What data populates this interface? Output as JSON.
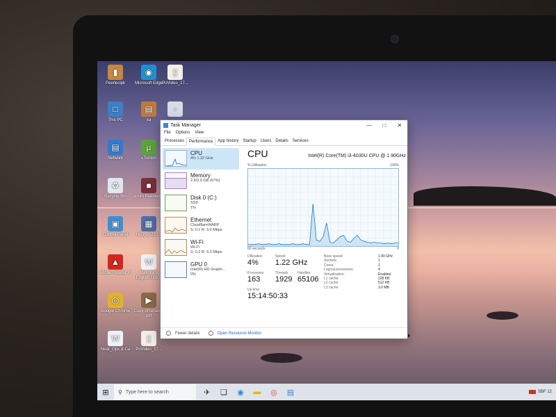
{
  "desktop": {
    "icons": [
      {
        "label": "Peerlecipk",
        "icon": "folder-icon",
        "color": "#c6893a"
      },
      {
        "label": "Microsoft Edge",
        "icon": "edge-icon",
        "color": "#1f8fd0"
      },
      {
        "label": "PoVideo_17...",
        "icon": "file-icon",
        "color": "#f4eee8"
      },
      {
        "label": "This PC",
        "icon": "computer-icon",
        "color": "#3b7fc9"
      },
      {
        "label": "xa",
        "icon": "archive-icon",
        "color": "#c07a3a"
      },
      {
        "label": "",
        "icon": "document-icon",
        "color": "#d7dce6"
      },
      {
        "label": "Network",
        "icon": "network-icon",
        "color": "#2f7bd0"
      },
      {
        "label": "uTorrent",
        "icon": "utorrent-icon",
        "color": "#5ba43a"
      },
      {
        "label": "Recycle Bin",
        "icon": "recycle-bin-icon",
        "color": "#dfe7ef"
      },
      {
        "label": "rerum Peerlecipk",
        "icon": "image-icon",
        "color": "#7a2f3a"
      },
      {
        "label": "Control Panel",
        "icon": "control-panel-icon",
        "color": "#3e8fcf"
      },
      {
        "label": "IMG_20230...",
        "icon": "photo-icon",
        "color": "#4d6fa6"
      },
      {
        "label": "Adobe Reader XI",
        "icon": "adobe-reader-icon",
        "color": "#d2271f"
      },
      {
        "label": "Stationary English Doc...",
        "icon": "word-icon",
        "color": "#eef2f8"
      },
      {
        "label": "Google Chrome",
        "icon": "chrome-icon",
        "color": "#e0b22c"
      },
      {
        "label": "Copy of rename pdf",
        "icon": "shortcut-icon",
        "color": "#8a6a48"
      },
      {
        "label": "Near_Ops & Ca",
        "icon": "word-doc-icon",
        "color": "#eef2f8"
      },
      {
        "label": "PoVideo_17...",
        "icon": "file-icon",
        "color": "#f4eee8"
      }
    ]
  },
  "taskmanager": {
    "title": "Task Manager",
    "menu": [
      "File",
      "Options",
      "View"
    ],
    "tabs": [
      "Processes",
      "Performance",
      "App history",
      "Startup",
      "Users",
      "Details",
      "Services"
    ],
    "active_tab": "Performance",
    "sidebar": [
      {
        "name": "CPU",
        "sub1": "4%  1.22 GHz",
        "sub2": ""
      },
      {
        "name": "Memory",
        "sub1": "2.6/3.9 GB (67%)",
        "sub2": ""
      },
      {
        "name": "Disk 0 (C:)",
        "sub1": "SSD",
        "sub2": "1%"
      },
      {
        "name": "Ethernet",
        "sub1": "CloudflareWARP",
        "sub2": "S: 0.1  R: 3.0 Mbps"
      },
      {
        "name": "Wi-Fi",
        "sub1": "Wi-Fi",
        "sub2": "S: 0.2  R: 3.2 Mbps"
      },
      {
        "name": "GPU 0",
        "sub1": "Intel(R) HD Graphi...",
        "sub2": "0%"
      }
    ],
    "panel": {
      "title": "CPU",
      "model": "Intel(R) Core(TM) i3-4030U CPU @ 1.90GHz",
      "graph_label_left": "% Utilization",
      "graph_label_right": "100%",
      "graph_foot_left": "60 seconds",
      "graph_foot_right": "0",
      "utilization": 0.04,
      "stats": {
        "utilization_label": "Utilization",
        "utilization_value": "4%",
        "speed_label": "Speed",
        "speed_value": "1.22 GHz",
        "processes_label": "Processes",
        "processes_value": "163",
        "threads_label": "Threads",
        "threads_value": "1929",
        "handles_label": "Handles",
        "handles_value": "65106",
        "uptime_label": "Up time",
        "uptime_value": "15:14:50:33"
      },
      "specs": [
        {
          "k": "Base speed:",
          "v": "1.90 GHz"
        },
        {
          "k": "Sockets:",
          "v": "1"
        },
        {
          "k": "Cores:",
          "v": "2"
        },
        {
          "k": "Logical processors:",
          "v": "4"
        },
        {
          "k": "Virtualization:",
          "v": "Enabled"
        },
        {
          "k": "L1 cache:",
          "v": "128 KB"
        },
        {
          "k": "L2 cache:",
          "v": "512 KB"
        },
        {
          "k": "L3 cache:",
          "v": "3.0 MB"
        }
      ]
    },
    "footer": {
      "fewer_details": "Fewer details",
      "open_monitor": "Open Resource Monitor"
    }
  },
  "cpu_history": [
    2,
    2,
    2,
    3,
    2,
    2,
    3,
    2,
    2,
    3,
    2,
    2,
    2,
    3,
    2,
    2,
    3,
    2,
    2,
    55,
    8,
    6,
    12,
    30,
    5,
    4,
    8,
    12,
    14,
    6,
    5,
    10,
    14,
    8,
    6,
    5,
    4,
    5,
    4,
    4,
    3,
    4,
    3,
    4,
    4
  ],
  "taskbar": {
    "search_placeholder": "Type here to search",
    "icons": [
      "start-icon",
      "search-icon",
      "pinned-app-icon",
      "task-view-icon",
      "edge-icon",
      "file-explorer-icon",
      "chrome-icon",
      "task-manager-icon"
    ],
    "tray_text": "SBF 12"
  }
}
